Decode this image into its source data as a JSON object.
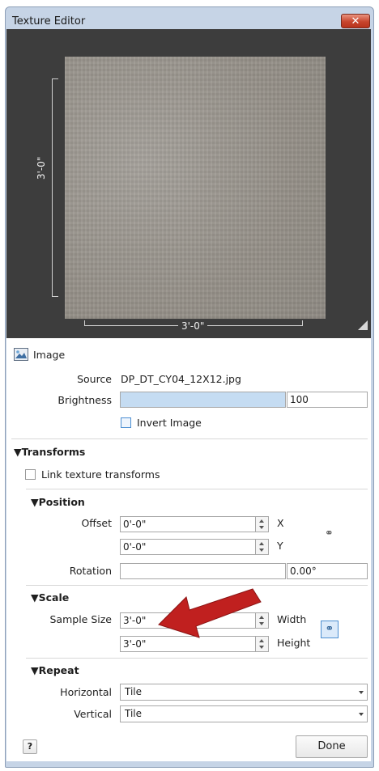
{
  "window": {
    "title": "Texture Editor",
    "close_label": "✕"
  },
  "preview": {
    "height_label": "3'-0\"",
    "width_label": "3'-0\""
  },
  "image_section": {
    "label": "Image",
    "source_label": "Source",
    "source_value": "DP_DT_CY04_12X12.jpg",
    "brightness_label": "Brightness",
    "brightness_value": "100",
    "invert_label": "Invert Image"
  },
  "transforms": {
    "header": "▼Transforms",
    "link_label": "Link texture transforms",
    "position": {
      "header": "▼Position",
      "offset_label": "Offset",
      "offset_x": "0'-0\"",
      "x_label": "X",
      "offset_y": "0'-0\"",
      "y_label": "Y",
      "rotation_label": "Rotation",
      "rotation_value": "0.00°"
    },
    "scale": {
      "header": "▼Scale",
      "sample_label": "Sample Size",
      "width_value": "3'-0\"",
      "width_label": "Width",
      "height_value": "3'-0\"",
      "height_label": "Height"
    },
    "repeat": {
      "header": "▼Repeat",
      "horizontal_label": "Horizontal",
      "horizontal_value": "Tile",
      "vertical_label": "Vertical",
      "vertical_value": "Tile"
    }
  },
  "footer": {
    "help_label": "?",
    "done_label": "Done"
  },
  "colors": {
    "arrow": "#c0201f",
    "accent": "#4b8ed1",
    "brightness_fill": "#c5dcf2"
  }
}
